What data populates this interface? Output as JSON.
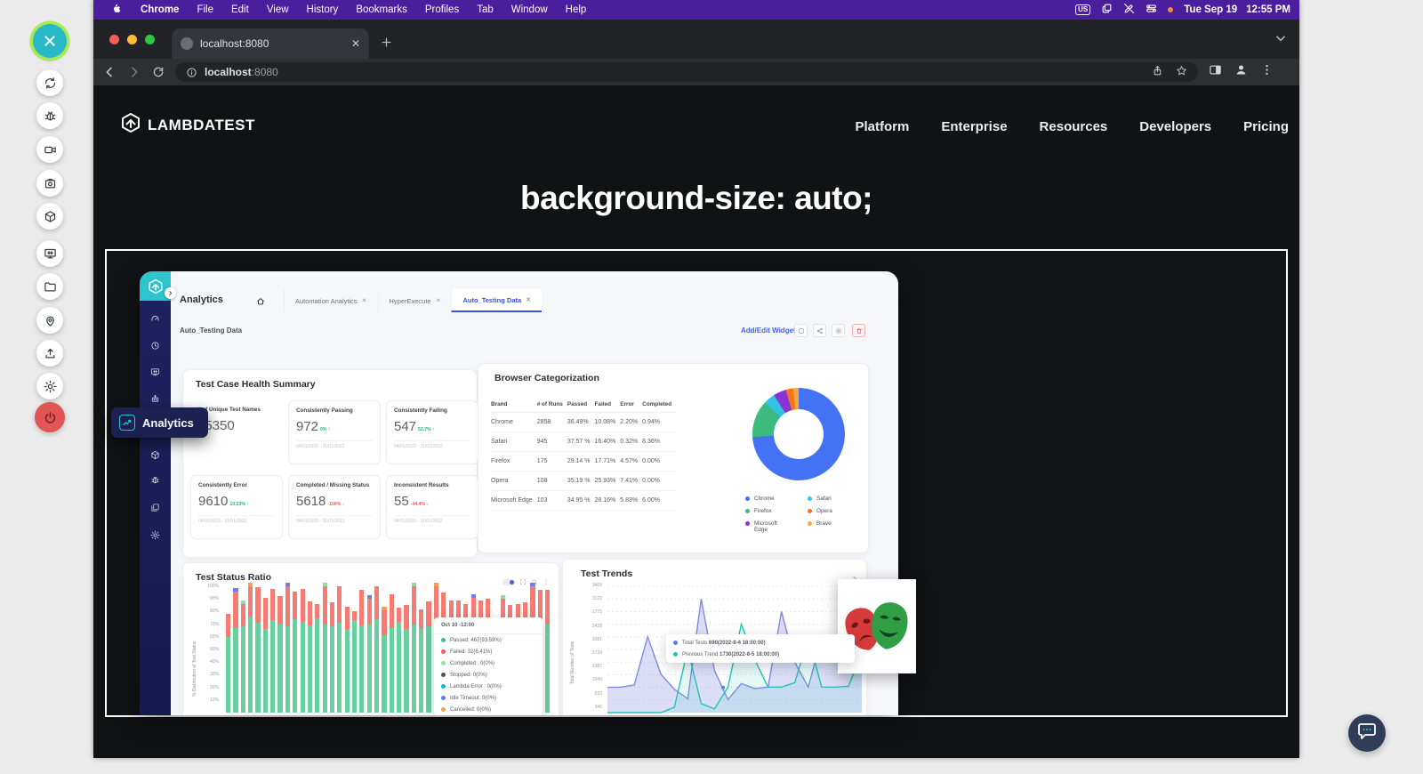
{
  "menubar": {
    "items": [
      "Chrome",
      "File",
      "Edit",
      "View",
      "History",
      "Bookmarks",
      "Profiles",
      "Tab",
      "Window",
      "Help"
    ],
    "keyboard_badge": "US",
    "date": "Tue Sep 19",
    "time": "12:55 PM"
  },
  "browser": {
    "tab_title": "localhost:8080",
    "url_host": "localhost",
    "url_port": ":8080"
  },
  "float_toolbar": [
    {
      "name": "close",
      "style": "primary"
    },
    {
      "name": "sync",
      "style": ""
    },
    {
      "name": "bug",
      "style": ""
    },
    {
      "name": "video",
      "style": ""
    },
    {
      "name": "screenshot",
      "style": ""
    },
    {
      "name": "package",
      "style": ""
    },
    {
      "name": "monitor",
      "style": ""
    },
    {
      "name": "folder",
      "style": ""
    },
    {
      "name": "location",
      "style": ""
    },
    {
      "name": "upload",
      "style": ""
    },
    {
      "name": "gear",
      "style": ""
    },
    {
      "name": "power",
      "style": "danger"
    }
  ],
  "site": {
    "logo_text": "LAMBDATEST",
    "nav": [
      "Platform",
      "Enterprise",
      "Resources",
      "Developers",
      "Pricing"
    ],
    "headline": "background-size: auto;"
  },
  "dashboard": {
    "app_title": "Analytics",
    "tabs": [
      {
        "label": "Automation Analytics",
        "active": false
      },
      {
        "label": "HyperExecute",
        "active": false
      },
      {
        "label": "Auto_Testing Data",
        "active": true
      }
    ],
    "subtitle": "Auto_Testing Data",
    "add_edit_label": "Add/Edit Widget",
    "sidebar_tooltip": "Analytics",
    "sidebar_icons": [
      "speedometer",
      "clock",
      "monitor",
      "robot",
      "package",
      "bug",
      "collection",
      "gear"
    ],
    "health": {
      "title": "Test Case Health Summary",
      "kpis": [
        {
          "label": "# of Unique Test Names",
          "value": "15350",
          "delta": "",
          "dir": "",
          "dates": "",
          "plain": true
        },
        {
          "label": "Consistently Passing",
          "value": "972",
          "delta": "0% ↑",
          "dir": "up",
          "dates": "04/01/2022 - 31/01/2022",
          "plain": false
        },
        {
          "label": "Consistently Failing",
          "value": "547",
          "delta": "52.7% ↑",
          "dir": "up",
          "dates": "04/01/2022 - 31/01/2022",
          "plain": false
        },
        {
          "label": "Consistently Error",
          "value": "9610",
          "delta": "10.23% ↑",
          "dir": "up",
          "dates": "04/01/2022 - 31/01/2022",
          "plain": false
        },
        {
          "label": "Completed / Missing Status",
          "value": "5618",
          "delta": "-100% ↓",
          "dir": "down",
          "dates": "04/01/2022 - 31/01/2022",
          "plain": false
        },
        {
          "label": "Inconsistent Results",
          "value": "55",
          "delta": "-44.4% ↓",
          "dir": "down",
          "dates": "04/01/2022 - 31/01/2022",
          "plain": false
        }
      ]
    },
    "browser_cat": {
      "title": "Browser Categorization",
      "columns": [
        "Brand",
        "# of Runs",
        "Passed",
        "Failed",
        "Error",
        "Completed"
      ],
      "rows": [
        {
          "brand": "Chrome",
          "runs": "2858",
          "passed": "36.49%",
          "failed": "10.08%",
          "error": "2.20%",
          "completed": "0.94%"
        },
        {
          "brand": "Safari",
          "runs": "945",
          "passed": "37.57 %",
          "failed": "16.40%",
          "error": "0.32%",
          "completed": "8.36%"
        },
        {
          "brand": "Firefox",
          "runs": "175",
          "passed": "29.14 %",
          "failed": "17.71%",
          "error": "4.57%",
          "completed": "0.00%"
        },
        {
          "brand": "Opera",
          "runs": "108",
          "passed": "35.19 %",
          "failed": "25.93%",
          "error": "7.41%",
          "completed": "0.00%"
        },
        {
          "brand": "Microsoft Edge",
          "runs": "103",
          "passed": "34.95 %",
          "failed": "28.16%",
          "error": "5.83%",
          "completed": "6.00%"
        }
      ],
      "legend_col1": [
        {
          "label": "Chrome",
          "color": "#4472f5"
        },
        {
          "label": "Firefox",
          "color": "#3dba7e"
        },
        {
          "label": "Microsoft Edge",
          "color": "#8833d6"
        }
      ],
      "legend_col2": [
        {
          "label": "Safari",
          "color": "#30c3e6"
        },
        {
          "label": "Opera",
          "color": "#f4731d"
        },
        {
          "label": "Brave",
          "color": "#f5a93d"
        }
      ]
    },
    "status_title": "Test Status Ratio",
    "trends_title": "Test Trends"
  },
  "chart_data": [
    {
      "type": "pie",
      "donut": true,
      "title": "Browser Categorization",
      "labels": [
        "Chrome",
        "Firefox",
        "Safari",
        "Microsoft Edge",
        "Opera",
        "Brave"
      ],
      "values_pct": [
        74,
        13,
        4,
        4.5,
        2.5,
        2
      ],
      "colors": [
        "#4472f5",
        "#3dba7e",
        "#30c3e6",
        "#8833d6",
        "#f4731d",
        "#f5a93d"
      ],
      "legend_position": "bottom"
    },
    {
      "type": "bar",
      "stacked": true,
      "title": "Test Status Ratio",
      "ylabel": "% Distribution of Test Status",
      "yticks": [
        "100%",
        "90%",
        "80%",
        "70%",
        "60%",
        "50%",
        "40%",
        "30%",
        "20%",
        "10%"
      ],
      "ylim": [
        0,
        100
      ],
      "series": [
        {
          "name": "Passed",
          "color": "#66d19e",
          "values": [
            60,
            67,
            68,
            76,
            71,
            66,
            73,
            70,
            68,
            74,
            72,
            69,
            75,
            70,
            68,
            71,
            66,
            73,
            69,
            70,
            74,
            61,
            67,
            72,
            66,
            70,
            67,
            68,
            66,
            70,
            69,
            71,
            69,
            70,
            68,
            71,
            43,
            60,
            58,
            52,
            55,
            64,
            69,
            70
          ]
        },
        {
          "name": "Failed",
          "color": "#f77b72",
          "values": [
            18,
            29,
            18,
            24,
            28,
            25,
            25,
            22,
            32,
            22,
            26,
            19,
            11,
            30,
            19,
            29,
            18,
            7,
            28,
            20,
            26,
            20,
            27,
            11,
            19,
            30,
            15,
            20,
            34,
            25,
            20,
            18,
            17,
            21,
            21,
            19,
            27,
            30,
            27,
            34,
            32,
            36,
            28,
            27
          ]
        }
      ],
      "caps": [
        "",
        "b",
        "g",
        "o",
        "",
        "",
        "",
        "",
        "b",
        "",
        "",
        "",
        "",
        "g",
        "",
        "",
        "",
        "",
        "",
        "b",
        "",
        "o",
        "",
        "",
        "",
        "g",
        "",
        "",
        "o",
        "",
        "",
        "",
        "",
        "b",
        "",
        "",
        "",
        "g",
        "",
        "",
        "",
        "b",
        "",
        ""
      ],
      "cap_colors": {
        "b": "#6b7ff2",
        "g": "#8ede9e",
        "o": "#f6a04d"
      },
      "tooltip": {
        "title": "Oct 10 -12:00",
        "entries": [
          {
            "color": "#3dbd94",
            "text": "Passed: 467(93.59%)"
          },
          {
            "color": "#f25c5c",
            "text": "Failed: 32(6.41%)"
          },
          {
            "color": "#9be09b",
            "text": "Completed : 0(0%)"
          },
          {
            "color": "#555555",
            "text": "Stopped: 0(0%)"
          },
          {
            "color": "#0bb7c9",
            "text": "Lambda Error : 0(0%)"
          },
          {
            "color": "#5b79f7",
            "text": "Idle Timeout: 0(0%)"
          },
          {
            "color": "#f6a04d",
            "text": "Cancelled: 0(0%)"
          }
        ]
      }
    },
    {
      "type": "line",
      "title": "Test Trends",
      "ylabel": "Total Number of Tests",
      "yticks": [
        "3469",
        "3122",
        "2775",
        "2428",
        "2081",
        "1734",
        "1387",
        "1040",
        "693",
        "346"
      ],
      "ylim": [
        0,
        3469
      ],
      "series": [
        {
          "name": "Total Tests",
          "color": "#8289e4",
          "fill": "rgba(130,137,228,0.28)",
          "values": [
            693,
            700,
            760,
            2081,
            1050,
            640,
            380,
            3122,
            1150,
            360,
            800,
            660,
            700,
            2775,
            1380,
            700,
            2081,
            1700,
            1387,
            1650
          ]
        },
        {
          "name": "Previous Trend",
          "color": "#24c3b4",
          "fill": "rgba(36,195,180,0.12)",
          "values": [
            0,
            0,
            0,
            0,
            0,
            150,
            1734,
            250,
            100,
            700,
            2428,
            1450,
            700,
            700,
            820,
            2081,
            700,
            700,
            720,
            1650
          ]
        }
      ],
      "tooltip": {
        "rows": [
          {
            "color": "#5b79f7",
            "label": "Total Tests",
            "value": "690(2022-8-4 18:00:00)"
          },
          {
            "color": "#24c3b4",
            "label": "Previous Trend",
            "value": "1730(2022-8-5 18:00:00)"
          }
        ]
      }
    }
  ]
}
